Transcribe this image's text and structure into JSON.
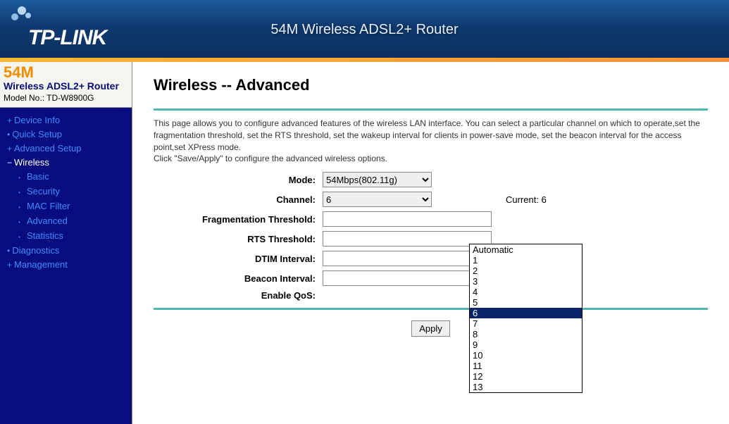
{
  "header": {
    "brand": "TP-LINK",
    "title": "54M Wireless ADSL2+ Router"
  },
  "sidebar": {
    "product_code": "54M",
    "product_line": "Wireless ADSL2+ Router",
    "model_label": "Model No.:",
    "model_no": "TD-W8900G",
    "items": [
      {
        "label": "Device Info",
        "expanded": false
      },
      {
        "label": "Quick Setup",
        "expanded": false
      },
      {
        "label": "Advanced Setup",
        "expanded": false
      },
      {
        "label": "Wireless",
        "expanded": true,
        "active": true,
        "children": [
          {
            "label": "Basic"
          },
          {
            "label": "Security"
          },
          {
            "label": "MAC Filter"
          },
          {
            "label": "Advanced"
          },
          {
            "label": "Statistics"
          }
        ]
      },
      {
        "label": "Diagnostics",
        "expanded": false
      },
      {
        "label": "Management",
        "expanded": false
      }
    ]
  },
  "page": {
    "title": "Wireless -- Advanced",
    "desc1": "This page allows you to configure advanced features of the wireless LAN interface. You can select a particular channel on which to operate,set the fragmentation threshold, set the RTS threshold, set the wakeup interval for clients in power-save mode, set the beacon interval for the access point,set XPress mode.",
    "desc2": "Click \"Save/Apply\" to configure the advanced wireless options.",
    "fields": {
      "mode_label": "Mode:",
      "mode_value": "54Mbps(802.11g)",
      "channel_label": "Channel:",
      "channel_value": "6",
      "channel_options": [
        "Automatic",
        "1",
        "2",
        "3",
        "4",
        "5",
        "6",
        "7",
        "8",
        "9",
        "10",
        "11",
        "12",
        "13"
      ],
      "current_label": "Current: 6",
      "frag_label": "Fragmentation Threshold:",
      "rts_label": "RTS Threshold:",
      "dtim_label": "DTIM Interval:",
      "beacon_label": "Beacon Interval:",
      "qos_label": "Enable QoS:"
    },
    "apply_label": "Apply"
  }
}
